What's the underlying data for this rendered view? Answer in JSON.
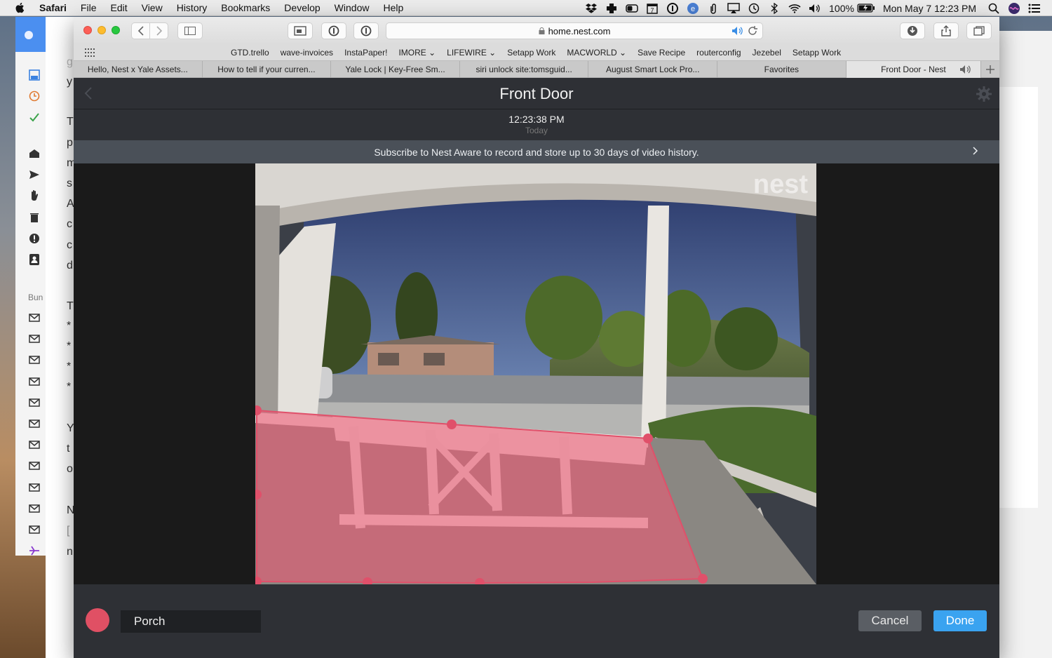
{
  "menubar": {
    "app_name": "Safari",
    "menus": [
      "File",
      "Edit",
      "View",
      "History",
      "Bookmarks",
      "Develop",
      "Window",
      "Help"
    ],
    "battery": "100%",
    "clock": "Mon May 7  12:23 PM"
  },
  "browser": {
    "url": "home.nest.com",
    "bookmarks": [
      "GTD.trello",
      "wave-invoices",
      "InstaPaper!",
      "IMORE ⌄",
      "LIFEWIRE ⌄",
      "Setapp Work",
      "MACWORLD ⌄",
      "Save Recipe",
      "routerconfig",
      "Jezebel",
      "Setapp Work"
    ],
    "tabs": [
      {
        "label": "Hello, Nest x Yale Assets..."
      },
      {
        "label": "How to tell if your curren..."
      },
      {
        "label": "Yale Lock | Key-Free Sm..."
      },
      {
        "label": "siri unlock site:tomsguid..."
      },
      {
        "label": "August Smart Lock Pro..."
      },
      {
        "label": "Favorites"
      },
      {
        "label": "Front Door - Nest"
      }
    ]
  },
  "nest": {
    "title": "Front Door",
    "time": "12:23:38 PM",
    "day": "Today",
    "banner": "Subscribe to Nest Aware to record and store up to 30 days of video history.",
    "watermark": "nest",
    "zone": {
      "name": "Porch",
      "color": "#e05064"
    },
    "cancel_label": "Cancel",
    "done_label": "Done"
  },
  "colors": {
    "accent": "#3aa3f0",
    "zone": "#e05064",
    "header_bg": "#2e3035"
  },
  "background_fragments": [
    "g",
    "y",
    "T",
    "p",
    "m",
    "s",
    "A",
    "c",
    "c",
    "d",
    "T",
    "*",
    "*",
    "*",
    "*",
    "Y",
    "t",
    "o",
    "N",
    "[",
    "n"
  ],
  "background_sidebar_label": "Bun"
}
